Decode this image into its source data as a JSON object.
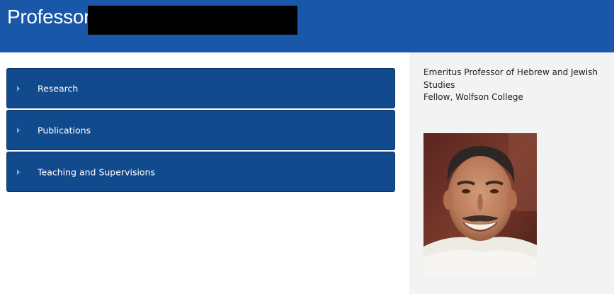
{
  "header": {
    "title": "Professor"
  },
  "accordion": {
    "items": [
      {
        "label": "Research"
      },
      {
        "label": "Publications"
      },
      {
        "label": "Teaching and Supervisions"
      }
    ]
  },
  "sidebar": {
    "bio_lines": [
      "Emeritus Professor of Hebrew and Jewish",
      "Studies",
      "Fellow, Wolfson College"
    ]
  },
  "colors": {
    "header_bg": "#1958a8",
    "accordion_bg": "#124a8e",
    "sidebar_bg": "#f3f3f3"
  }
}
